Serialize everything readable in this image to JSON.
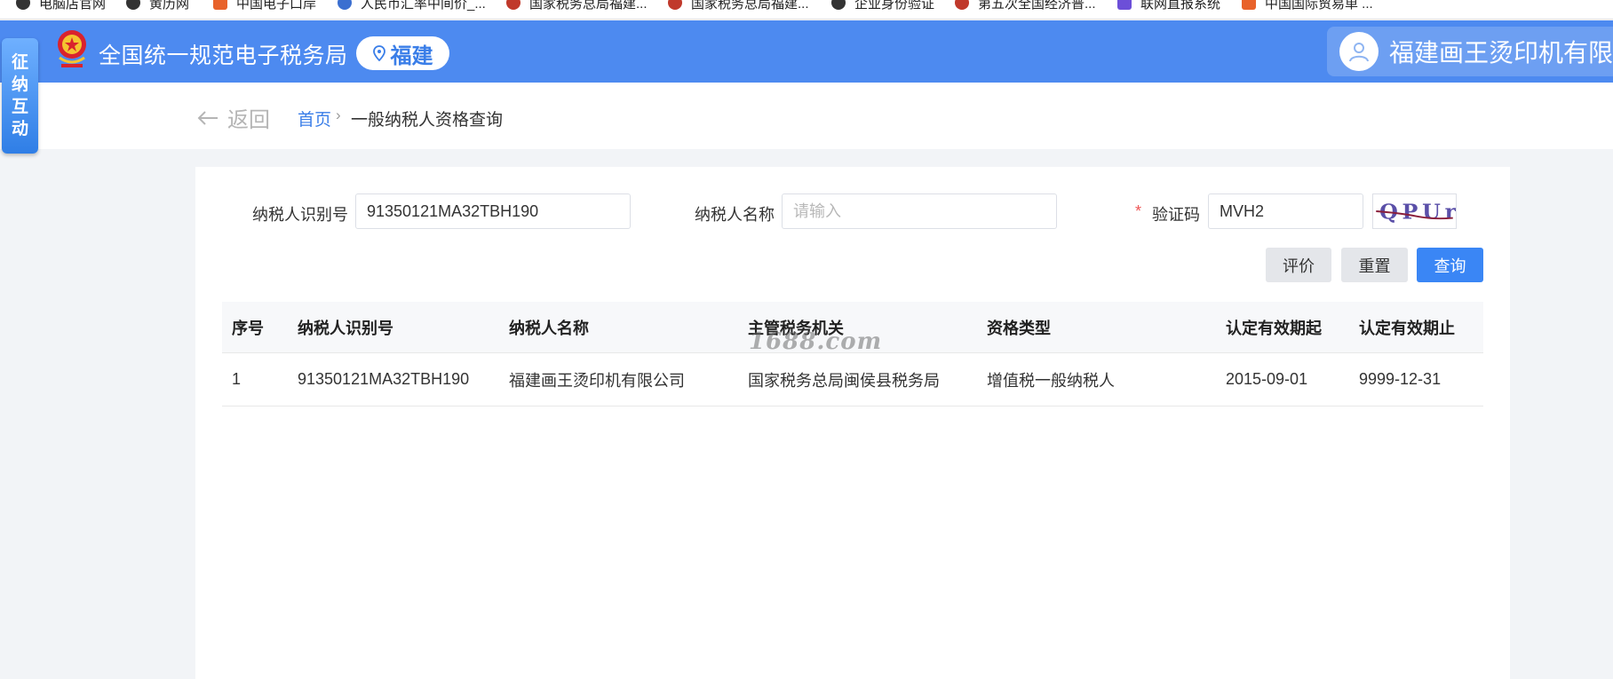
{
  "bookmarks": [
    {
      "label": "电脑店官网",
      "icon": "globe-icon",
      "color": "#333333"
    },
    {
      "label": "黄历网",
      "icon": "globe-icon",
      "color": "#333333"
    },
    {
      "label": "中国电子口岸",
      "icon": "port-icon",
      "color": "#e8622a"
    },
    {
      "label": "人民币汇率中间价_...",
      "icon": "bank-icon",
      "color": "#3b6fd0"
    },
    {
      "label": "国家税务总局福建...",
      "icon": "tax-icon",
      "color": "#c0392b"
    },
    {
      "label": "国家税务总局福建...",
      "icon": "tax-icon",
      "color": "#c0392b"
    },
    {
      "label": "企业身份验证",
      "icon": "globe-icon",
      "color": "#333333"
    },
    {
      "label": "第五次全国经济普...",
      "icon": "census-icon",
      "color": "#c0392b"
    },
    {
      "label": "联网直报系统",
      "icon": "network-icon",
      "color": "#6c4fd8"
    },
    {
      "label": "中国国际贸易单 ...",
      "icon": "trade-icon",
      "color": "#e8622a"
    }
  ],
  "header": {
    "site_title": "全国统一规范电子税务局",
    "region": "福建",
    "user_name": "福建画王烫印机有限公司",
    "bg_color": "#4d8af0"
  },
  "side_tab": {
    "chars": [
      "征",
      "纳",
      "互",
      "动"
    ]
  },
  "breadcrumb": {
    "back_label": "返回",
    "home": "首页",
    "separator": "›",
    "current": "一般纳税人资格查询"
  },
  "form": {
    "taxpayer_id_label": "纳税人识别号",
    "taxpayer_id_value": "91350121MA32TBH190",
    "taxpayer_name_label": "纳税人名称",
    "taxpayer_name_placeholder": "请输入",
    "captcha_required_mark": "*",
    "captcha_label": "验证码",
    "captcha_value": "MVH2",
    "captcha_image_text": "QPUr"
  },
  "buttons": {
    "evaluate": "评价",
    "reset": "重置",
    "query": "查询",
    "accent_color": "#3a86f5"
  },
  "table": {
    "headers": [
      "序号",
      "纳税人识别号",
      "纳税人名称",
      "主管税务机关",
      "资格类型",
      "认定有效期起",
      "认定有效期止"
    ],
    "rows": [
      [
        "1",
        "91350121MA32TBH190",
        "福建画王烫印机有限公司",
        "国家税务总局闽侯县税务局",
        "增值税一般纳税人",
        "2015-09-01",
        "9999-12-31"
      ]
    ]
  },
  "watermark": "1688.com"
}
